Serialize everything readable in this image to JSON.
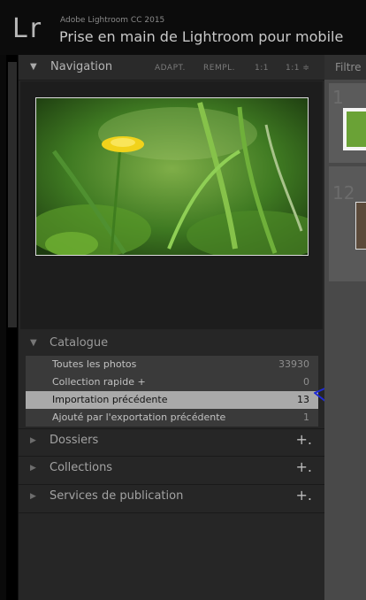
{
  "titlebar": {
    "logo": "Lr",
    "app_name": "Adobe Lightroom CC 2015",
    "catalog_name": "Prise en main de Lightroom pour mobile"
  },
  "navigator": {
    "title": "Navigation",
    "zoom_options": [
      "ADAPT.",
      "REMPL.",
      "1:1",
      "1:1 ≑"
    ]
  },
  "catalog": {
    "title": "Catalogue",
    "items": [
      {
        "label": "Toutes les photos",
        "count": "33930"
      },
      {
        "label": "Collection rapide +",
        "count": "0"
      },
      {
        "label": "Importation précédente",
        "count": "13"
      },
      {
        "label": "Ajouté par l'exportation précédente",
        "count": "1"
      }
    ]
  },
  "sections": [
    {
      "label": "Dossiers",
      "action": "+."
    },
    {
      "label": "Collections",
      "action": "+."
    },
    {
      "label": "Services de publication",
      "action": "+."
    }
  ],
  "filmstrip": {
    "filter_label": "Filtre",
    "numbers": [
      "1",
      "12"
    ]
  },
  "colors": {
    "accent_annotation": "#1f2bd6",
    "selected_row": "#a9a9a9",
    "panel": "#262626"
  }
}
